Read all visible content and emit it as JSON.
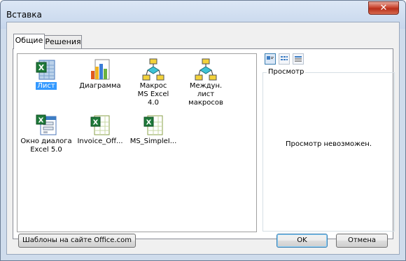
{
  "window": {
    "title": "Вставка"
  },
  "tabs": [
    {
      "label": "Общие",
      "active": true
    },
    {
      "label": "Решения",
      "active": false
    }
  ],
  "items": [
    {
      "label": "Лист",
      "icon": "excel-worksheet-icon",
      "selected": true
    },
    {
      "label": "Диаграмма",
      "icon": "chart-sheet-icon",
      "selected": false
    },
    {
      "label": "Макрос MS Excel 4.0",
      "icon": "macro-sheet-icon",
      "selected": false
    },
    {
      "label": "Междун. лист макросов",
      "icon": "international-macro-sheet-icon",
      "selected": false
    },
    {
      "label": "Окно диалога Excel 5.0",
      "icon": "dialog-sheet-icon",
      "selected": false
    },
    {
      "label": "Invoice_Off...",
      "icon": "excel-template-icon",
      "selected": false
    },
    {
      "label": "MS_SimpleI...",
      "icon": "excel-template-icon",
      "selected": false
    }
  ],
  "view_buttons": [
    {
      "name": "large-icons-view",
      "active": true
    },
    {
      "name": "list-view",
      "active": false
    },
    {
      "name": "details-view",
      "active": false
    }
  ],
  "preview": {
    "legend": "Просмотр",
    "message": "Просмотр невозможен."
  },
  "buttons": {
    "templates": "Шаблоны на сайте Office.com",
    "ok": "OK",
    "cancel": "Отмена"
  },
  "colors": {
    "title_bar": "#c6d6ec",
    "selection": "#3399ff",
    "close_button": "#c9452f"
  }
}
